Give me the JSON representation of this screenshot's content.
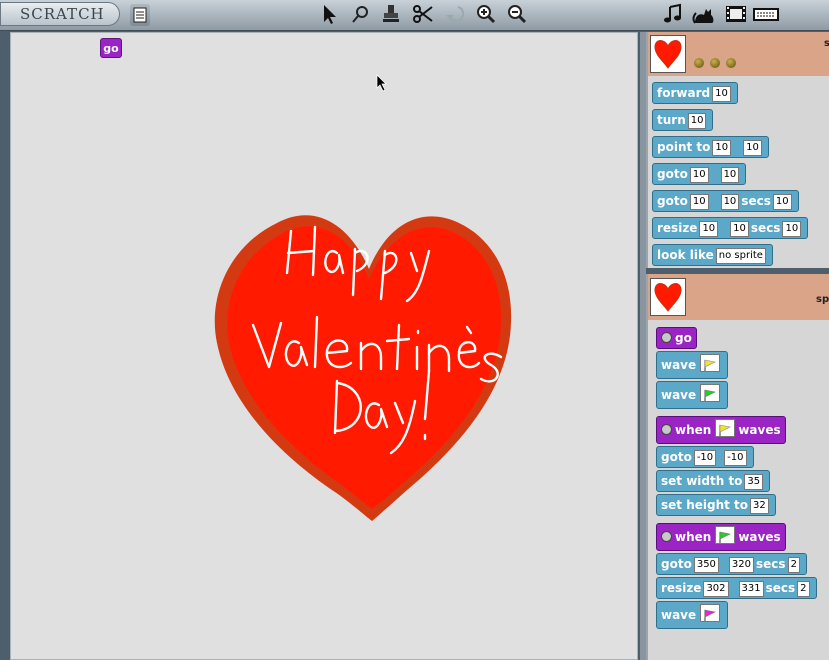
{
  "app": {
    "logo": "SCRATCH"
  },
  "toolbar": {
    "tools": [
      "arrow-icon",
      "magnify-icon",
      "stamp-icon",
      "scissors-icon",
      "undo-icon",
      "zoom-in-icon",
      "zoom-out-icon"
    ],
    "right_icons": [
      "music-note-icon",
      "cat-icon",
      "film-icon",
      "keyboard-icon"
    ]
  },
  "stage": {
    "go_label": "go",
    "card_lines": [
      "Happy",
      "Valentine's",
      "Day!"
    ]
  },
  "sprite_panel_1": {
    "header_text": "s",
    "blocks": [
      {
        "label": "forward",
        "args": [
          "10"
        ]
      },
      {
        "label": "turn",
        "args": [
          "10"
        ]
      },
      {
        "label": "point to",
        "args": [
          "10",
          "10"
        ]
      },
      {
        "label": "goto",
        "args": [
          "10",
          "10"
        ]
      },
      {
        "label": "goto",
        "args": [
          "10",
          "10"
        ],
        "label2": "secs",
        "args2": [
          "10"
        ]
      },
      {
        "label": "resize",
        "args": [
          "10",
          "10"
        ],
        "label2": "secs",
        "args2": [
          "10"
        ]
      },
      {
        "label": "look like",
        "args": [
          "no sprite"
        ]
      }
    ]
  },
  "sprite_panel_2": {
    "header_text": "sp",
    "script": {
      "go_label": "go",
      "wave1": "wave",
      "wave2": "wave",
      "when1": "when",
      "waves1": "waves",
      "goto1": {
        "label": "goto",
        "x": "-10",
        "y": "-10"
      },
      "setw": {
        "label": "set width to",
        "value": "35"
      },
      "seth": {
        "label": "set height to",
        "value": "32"
      },
      "when2": "when",
      "waves2": "waves",
      "goto2": {
        "label": "goto",
        "x": "350",
        "y": "320",
        "secs_label": "secs",
        "secs": "2"
      },
      "resize2": {
        "label": "resize",
        "w": "302",
        "h": "331",
        "secs_label": "secs",
        "secs": "2"
      },
      "wave3": "wave"
    }
  },
  "colors": {
    "heart_red": "#ff1a00",
    "block_blue": "#5ba8c8",
    "block_purple": "#9a24c4",
    "flag_yellow": "#f2e22a",
    "flag_green": "#22d022",
    "flag_pink": "#ee22cc"
  }
}
